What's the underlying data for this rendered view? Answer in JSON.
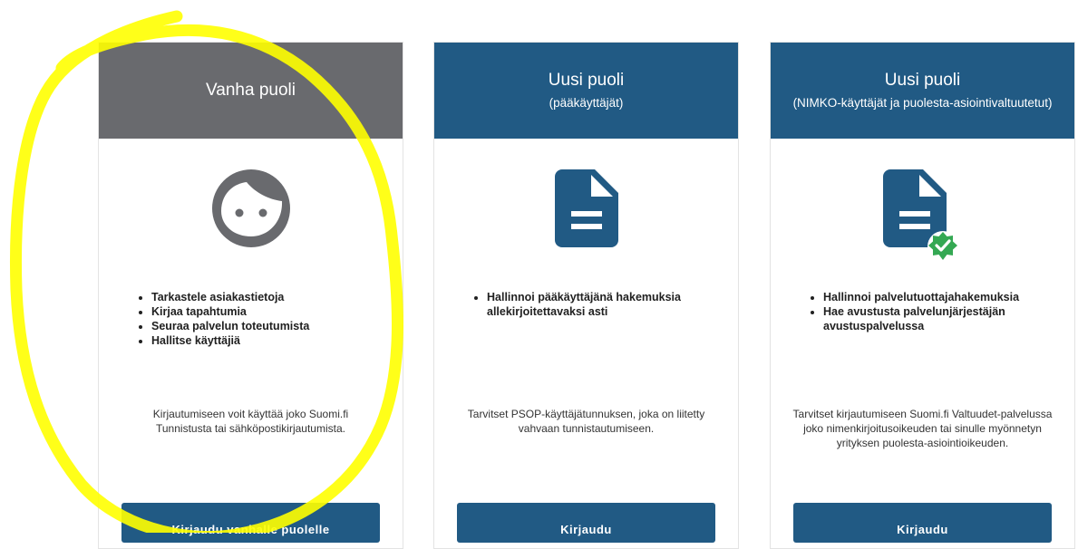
{
  "colors": {
    "header_grey": "#696a6e",
    "header_blue": "#215a84",
    "button_blue": "#215a84",
    "check_green": "#34a853",
    "highlight_yellow": "#ffff00"
  },
  "cards": [
    {
      "title": "Vanha puoli",
      "subtitle": "",
      "icon": "face-icon",
      "features": [
        "Tarkastele asiakastietoja",
        "Kirjaa tapahtumia",
        "Seuraa palvelun toteutumista",
        "Hallitse käyttäjiä"
      ],
      "note": "Kirjautumiseen voit käyttää joko Suomi.fi Tunnistusta tai sähköpostikirjautumista.",
      "button": "Kirjaudu vanhalle puolelle"
    },
    {
      "title": "Uusi puoli",
      "subtitle": "(pääkäyttäjät)",
      "icon": "document-icon",
      "features": [
        "Hallinnoi pääkäyttäjänä hakemuksia allekirjoitettavaksi asti"
      ],
      "note": "Tarvitset PSOP-käyttäjätunnuksen, joka on liitetty vahvaan tunnistautumiseen.",
      "button": "Kirjaudu"
    },
    {
      "title": "Uusi puoli",
      "subtitle": "(NIMKO-käyttäjät ja puolesta-asiointivaltuutetut)",
      "icon": "verified-document-icon",
      "features": [
        "Hallinnoi palvelutuottajahakemuksia",
        "Hae avustusta palvelunjärjestäjän avustuspalvelussa"
      ],
      "note": "Tarvitset kirjautumiseen Suomi.fi Valtuudet-palvelussa joko nimenkirjoitusoikeuden tai sinulle myönnetyn yrityksen puolesta-asiointioikeuden.",
      "button": "Kirjaudu"
    }
  ]
}
